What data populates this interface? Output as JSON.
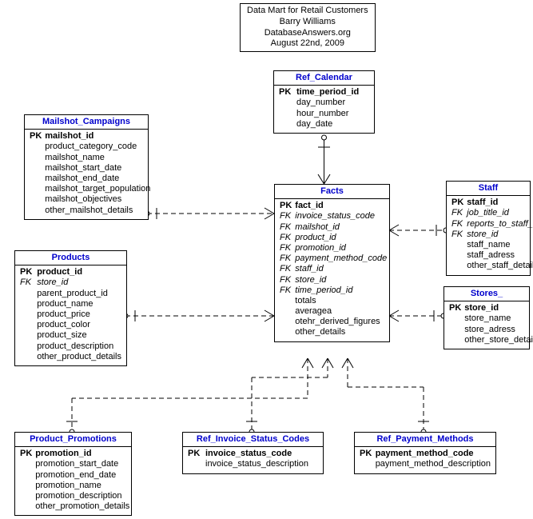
{
  "title": {
    "line1": "Data Mart for Retail Customers",
    "line2": "Barry Williams",
    "line3": "DatabaseAnswers.org",
    "line4": "August 22nd, 2009"
  },
  "entities": {
    "ref_calendar": {
      "name": "Ref_Calendar",
      "attrs": [
        {
          "key": "PK",
          "name": "time_period_id"
        },
        {
          "key": "",
          "name": "day_number"
        },
        {
          "key": "",
          "name": "hour_number"
        },
        {
          "key": "",
          "name": "day_date"
        }
      ]
    },
    "mailshot_campaigns": {
      "name": "Mailshot_Campaigns",
      "attrs": [
        {
          "key": "PK",
          "name": "mailshot_id"
        },
        {
          "key": "",
          "name": "product_category_code"
        },
        {
          "key": "",
          "name": "mailshot_name"
        },
        {
          "key": "",
          "name": "mailshot_start_date"
        },
        {
          "key": "",
          "name": "mailshot_end_date"
        },
        {
          "key": "",
          "name": "mailshot_target_population"
        },
        {
          "key": "",
          "name": "mailshot_objectives"
        },
        {
          "key": "",
          "name": "other_mailshot_details"
        }
      ]
    },
    "products": {
      "name": "Products",
      "attrs": [
        {
          "key": "PK",
          "name": "product_id"
        },
        {
          "key": "FK",
          "name": "store_id"
        },
        {
          "key": "",
          "name": "parent_product_id"
        },
        {
          "key": "",
          "name": "product_name"
        },
        {
          "key": "",
          "name": "product_price"
        },
        {
          "key": "",
          "name": "product_color"
        },
        {
          "key": "",
          "name": "product_size"
        },
        {
          "key": "",
          "name": "product_description"
        },
        {
          "key": "",
          "name": "other_product_details"
        }
      ]
    },
    "facts": {
      "name": "Facts",
      "attrs": [
        {
          "key": "PK",
          "name": "fact_id"
        },
        {
          "key": "FK",
          "name": "invoice_status_code"
        },
        {
          "key": "FK",
          "name": "mailshot_id"
        },
        {
          "key": "FK",
          "name": "product_id"
        },
        {
          "key": "FK",
          "name": "promotion_id"
        },
        {
          "key": "FK",
          "name": "payment_method_code"
        },
        {
          "key": "FK",
          "name": "staff_id"
        },
        {
          "key": "FK",
          "name": "store_id"
        },
        {
          "key": "FK",
          "name": "time_period_id"
        },
        {
          "key": "",
          "name": "totals"
        },
        {
          "key": "",
          "name": "averagea"
        },
        {
          "key": "",
          "name": "otehr_derived_figures"
        },
        {
          "key": "",
          "name": "other_details"
        }
      ]
    },
    "staff": {
      "name": "Staff",
      "attrs": [
        {
          "key": "PK",
          "name": "staff_id"
        },
        {
          "key": "FK",
          "name": "job_title_id"
        },
        {
          "key": "FK",
          "name": "reports_to_staff_id"
        },
        {
          "key": "FK",
          "name": "store_id"
        },
        {
          "key": "",
          "name": "staff_name"
        },
        {
          "key": "",
          "name": "staff_adress"
        },
        {
          "key": "",
          "name": "other_staff_details"
        }
      ]
    },
    "stores": {
      "name": "Stores_",
      "attrs": [
        {
          "key": "PK",
          "name": "store_id"
        },
        {
          "key": "",
          "name": "store_name"
        },
        {
          "key": "",
          "name": "store_adress"
        },
        {
          "key": "",
          "name": "other_store_details"
        }
      ]
    },
    "product_promotions": {
      "name": "Product_Promotions",
      "attrs": [
        {
          "key": "PK",
          "name": "promotion_id"
        },
        {
          "key": "",
          "name": "promotion_start_date"
        },
        {
          "key": "",
          "name": "promotion_end_date"
        },
        {
          "key": "",
          "name": "promotion_name"
        },
        {
          "key": "",
          "name": "promotion_description"
        },
        {
          "key": "",
          "name": "other_promotion_details"
        }
      ]
    },
    "ref_invoice_status_codes": {
      "name": "Ref_Invoice_Status_Codes",
      "attrs": [
        {
          "key": "PK",
          "name": "invoice_status_code"
        },
        {
          "key": "",
          "name": "invoice_status_description"
        }
      ]
    },
    "ref_payment_methods": {
      "name": "Ref_Payment_Methods",
      "attrs": [
        {
          "key": "PK",
          "name": "payment_method_code"
        },
        {
          "key": "",
          "name": "payment_method_description"
        }
      ]
    }
  },
  "relationships": [
    {
      "from": "ref_calendar",
      "to": "facts",
      "type": "one-to-many"
    },
    {
      "from": "mailshot_campaigns",
      "to": "facts",
      "type": "one-to-many"
    },
    {
      "from": "products",
      "to": "facts",
      "type": "one-to-many"
    },
    {
      "from": "staff",
      "to": "facts",
      "type": "one-to-many"
    },
    {
      "from": "stores",
      "to": "facts",
      "type": "one-to-many"
    },
    {
      "from": "product_promotions",
      "to": "facts",
      "type": "one-to-many"
    },
    {
      "from": "ref_invoice_status_codes",
      "to": "facts",
      "type": "one-to-many"
    },
    {
      "from": "ref_payment_methods",
      "to": "facts",
      "type": "one-to-many"
    }
  ]
}
